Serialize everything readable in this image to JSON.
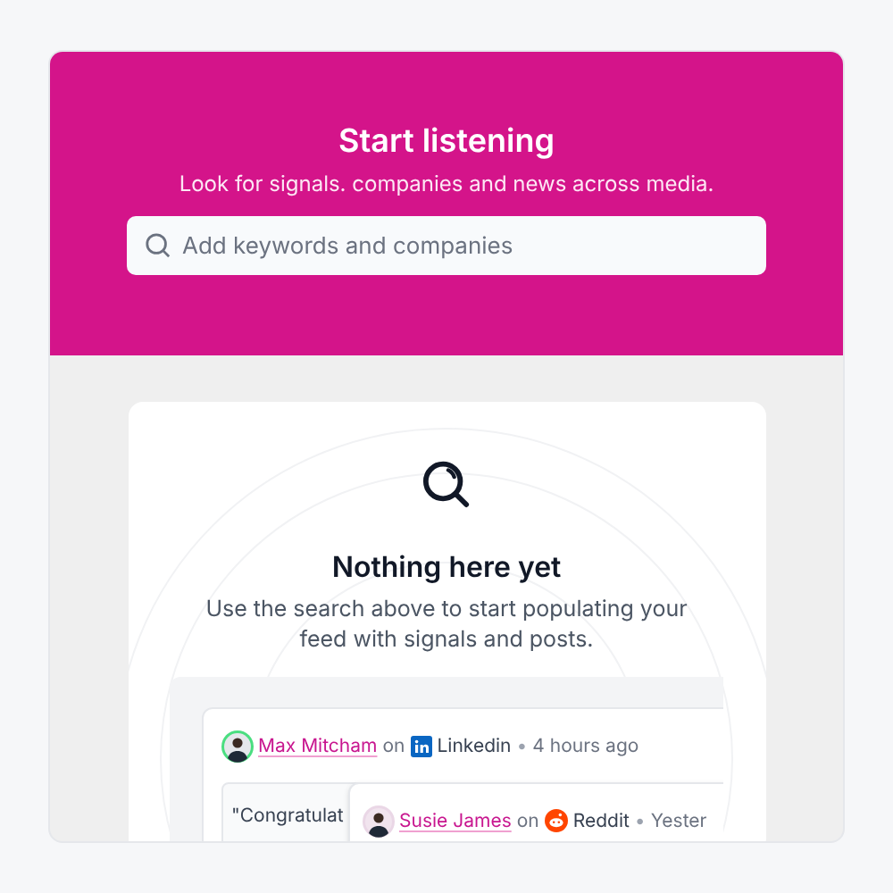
{
  "header": {
    "title": "Start listening",
    "subtitle": "Look for signals. companies and news across media.",
    "search": {
      "placeholder": "Add keywords and companies"
    }
  },
  "empty_state": {
    "title": "Nothing here yet",
    "description": "Use the search above to start populating your feed with signals and posts."
  },
  "posts": [
    {
      "author": "Max Mitcham",
      "on": "on",
      "platform": "Linkedin",
      "kind": "linkedin",
      "separator": "•",
      "time": "4 hours ago",
      "quote": "\"Congratulat"
    },
    {
      "author": "Susie James",
      "on": "on",
      "platform": "Reddit",
      "kind": "reddit",
      "separator": "•",
      "time": "Yester"
    }
  ]
}
